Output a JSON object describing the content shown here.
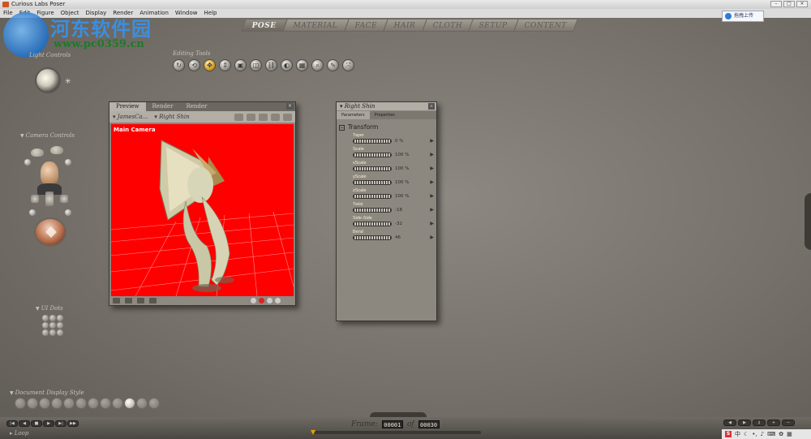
{
  "window": {
    "title": "Curious Labs Poser"
  },
  "menu": [
    "File",
    "Edit",
    "Figure",
    "Object",
    "Display",
    "Render",
    "Animation",
    "Window",
    "Help"
  ],
  "cloud_upload": "拖拽上传",
  "watermark": {
    "title": "河东软件园",
    "url": "www.pc0359.cn"
  },
  "rooms": [
    "POSE",
    "MATERIAL",
    "FACE",
    "HAIR",
    "CLOTH",
    "SETUP",
    "CONTENT"
  ],
  "active_room": "POSE",
  "labels": {
    "light_controls": "Light Controls",
    "editing_tools": "Editing Tools",
    "camera_controls": "Camera Controls",
    "ui_dots": "UI Dots",
    "doc_display": "Document Display Style",
    "loop": "Loop",
    "frame": "Frame:",
    "of": "of"
  },
  "document": {
    "tabs": [
      "Preview",
      "Render",
      "Render"
    ],
    "camera_menu": "JamesCa...",
    "figure_menu": "Right Shin",
    "viewport_label": "Main Camera",
    "bg_color": "#ff0000"
  },
  "parameters": {
    "title": "Right Shin",
    "tabs": [
      "Parameters",
      "Properties"
    ],
    "group": "Transform",
    "rows": [
      {
        "name": "Taper",
        "value": "0 %"
      },
      {
        "name": "Scale",
        "value": "100 %"
      },
      {
        "name": "xScale",
        "value": "100 %"
      },
      {
        "name": "yScale",
        "value": "100 %"
      },
      {
        "name": "zScale",
        "value": "100 %"
      },
      {
        "name": "Twist",
        "value": "-18"
      },
      {
        "name": "Side-Side",
        "value": "-32"
      },
      {
        "name": "Bend",
        "value": "46"
      }
    ]
  },
  "frame": {
    "current": "00001",
    "total": "00030"
  },
  "colors": {
    "accent": "#d9a020",
    "viewport": "#ff0000"
  }
}
